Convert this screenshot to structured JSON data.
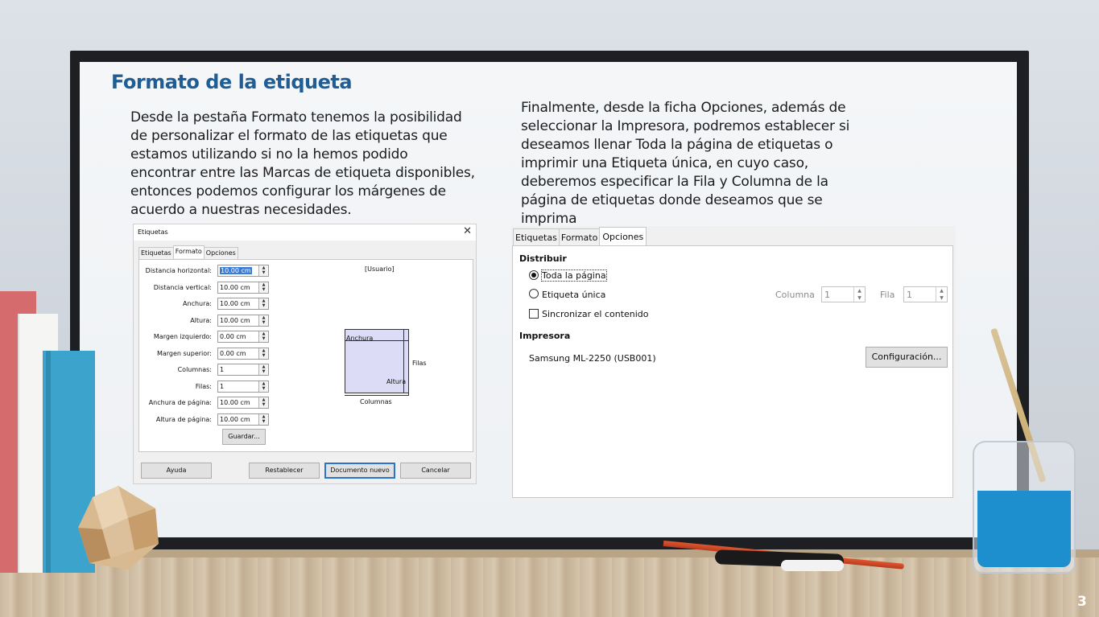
{
  "slide": {
    "title": "Formato de la etiqueta",
    "left_text": "Desde la pestaña Formato tenemos la posibilidad\nde personalizar el formato de las etiquetas que\nestamos utilizando si no la hemos podido\nencontrar entre las Marcas de etiqueta disponibles,\nentonces podemos configurar los márgenes de\nacuerdo a nuestras necesidades.",
    "right_text": "Finalmente, desde la ficha Opciones, además de\nseleccionar la Impresora, podremos establecer si\ndeseamos llenar Toda la página de etiquetas o\nimprimir una Etiqueta única, en cuyo caso,\ndeberemos especificar la Fila y Columna de la\npágina de etiquetas donde deseamos que se\nimprima",
    "page_number": "3"
  },
  "dialog_format": {
    "title": "Etiquetas",
    "close_glyph": "✕",
    "tabs": [
      "Etiquetas",
      "Formato",
      "Opciones"
    ],
    "active_tab": "Formato",
    "fields": [
      {
        "label": "Distancia horizontal:",
        "value": "10.00 cm"
      },
      {
        "label": "Distancia vertical:",
        "value": "10.00 cm"
      },
      {
        "label": "Anchura:",
        "value": "10.00 cm"
      },
      {
        "label": "Altura:",
        "value": "10.00 cm"
      },
      {
        "label": "Margen izquierdo:",
        "value": "0.00 cm"
      },
      {
        "label": "Margen superior:",
        "value": "0.00 cm"
      },
      {
        "label": "Columnas:",
        "value": "1"
      },
      {
        "label": "Filas:",
        "value": "1"
      },
      {
        "label": "Anchura de página:",
        "value": "10.00 cm"
      },
      {
        "label": "Altura de página:",
        "value": "10.00 cm"
      }
    ],
    "preset_label": "[Usuario]",
    "diagram": {
      "width_label": "Anchura",
      "height_label": "Altura",
      "rows_label": "Filas",
      "cols_label": "Columnas"
    },
    "save_button": "Guardar...",
    "buttons": {
      "help": "Ayuda",
      "reset": "Restablecer",
      "new_document": "Documento nuevo",
      "cancel": "Cancelar"
    }
  },
  "dialog_options": {
    "tabs": [
      "Etiquetas",
      "Formato",
      "Opciones"
    ],
    "active_tab": "Opciones",
    "distribute_heading": "Distribuir",
    "option_full_page": "Toda la página",
    "option_single_label": "Etiqueta única",
    "column_label": "Columna",
    "column_value": "1",
    "row_label": "Fila",
    "row_value": "1",
    "sync_label": "Sincronizar el contenido",
    "printer_heading": "Impresora",
    "printer_name": "Samsung ML-2250 (USB001)",
    "config_button": "Configuración..."
  }
}
